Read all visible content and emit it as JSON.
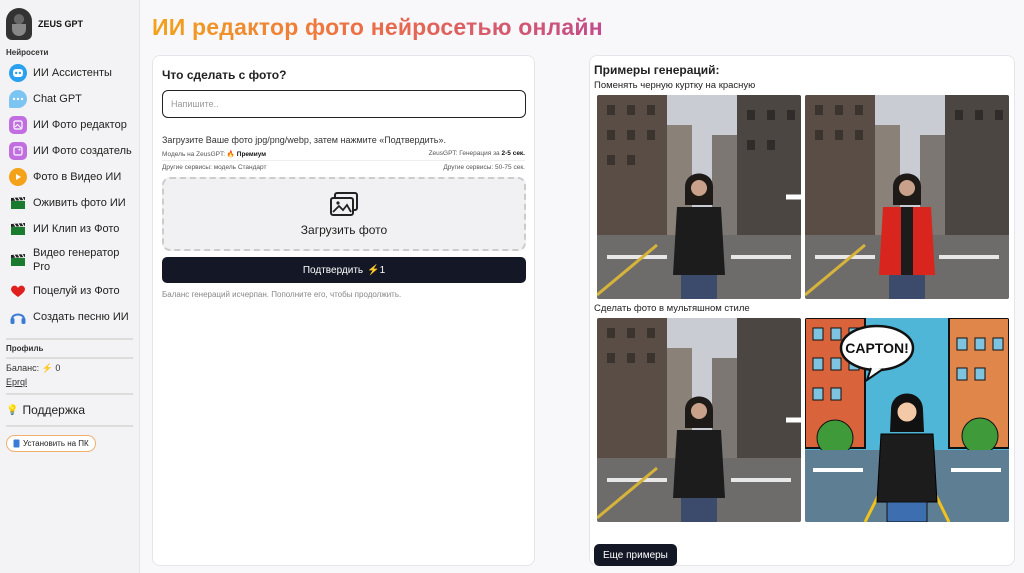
{
  "brand": {
    "name": "ZEUS GPT"
  },
  "sidebar": {
    "section_label": "Нейросети",
    "items": [
      {
        "label": "ИИ Ассистенты",
        "icon": "assistant-icon",
        "color": "#2aa0f0"
      },
      {
        "label": "Chat GPT",
        "icon": "chat-bubble-icon",
        "color": "#7cc4f2"
      },
      {
        "label": "ИИ Фото редактор",
        "icon": "photo-editor-icon",
        "color": "#c06ee0"
      },
      {
        "label": "ИИ Фото создатель",
        "icon": "photo-creator-icon",
        "color": "#c06ee0"
      },
      {
        "label": "Фото в Видео ИИ",
        "icon": "photo-to-video-icon",
        "color": "#f4a21a"
      },
      {
        "label": "Оживить фото ИИ",
        "icon": "clapper-icon",
        "color": "#1a7a2e"
      },
      {
        "label": "ИИ Клип из Фото",
        "icon": "clapper-icon",
        "color": "#1a7a2e"
      },
      {
        "label": "Видео генератор Pro",
        "icon": "clapper-icon",
        "color": "#1a7a2e"
      },
      {
        "label": "Поцелуй из Фото",
        "icon": "heart-icon",
        "color": "#e0201e"
      },
      {
        "label": "Создать песню ИИ",
        "icon": "headphones-icon",
        "color": "#3b7bd8"
      }
    ],
    "profile_label": "Профиль",
    "balance_label": "Баланс:",
    "balance_value": "0",
    "user_name": "Eprql",
    "support_label": "Поддержка",
    "install_label": "Установить на ПК"
  },
  "main": {
    "title": "ИИ редактор фото нейросетью онлайн",
    "question": "Что сделать с фото?",
    "input_placeholder": "Напишите..",
    "hint": "Загрузите Ваше фото jpg/png/webp, затем нажмите «Подтвердить».",
    "model_left_prefix": "Модель на ZeusGPT:",
    "model_left_value": "Премиум",
    "model_right_prefix": "ZeusGPT: Генерация за",
    "model_right_value": "2-5 сек.",
    "other_left": "Другие сервисы: модель Стандарт",
    "other_right": "Другие сервисы: 50-75 сек.",
    "upload_label": "Загрузить фото",
    "confirm_label": "Подтвердить",
    "confirm_cost": "1",
    "balance_note": "Баланс генераций исчерпан. Пополните его, чтобы продолжить."
  },
  "examples": {
    "title": "Примеры генераций:",
    "items": [
      {
        "caption": "Поменять черную куртку на красную"
      },
      {
        "caption": "Сделать фото в мультяшном стиле",
        "speech_text": "CAPTON!"
      }
    ],
    "more_label": "Еще примеры"
  },
  "colors": {
    "accent_dark": "#141826",
    "title_gradient": [
      "#f2a31c",
      "#ee6f43",
      "#c34b8b"
    ],
    "jacket_black": "#1c1c1c",
    "jacket_red": "#d8261e"
  }
}
